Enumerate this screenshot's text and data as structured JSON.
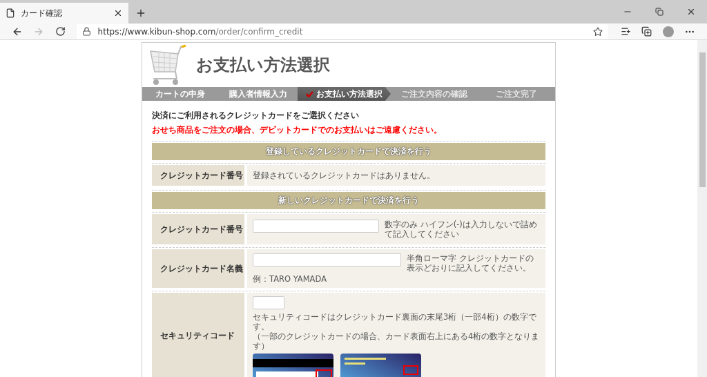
{
  "browser": {
    "tab_title": "カード確認",
    "url_host": "https://www.kibun-shop.com",
    "url_path": "/order/confirm_credit"
  },
  "page": {
    "title": "お支払い方法選択",
    "steps": [
      {
        "label": "カートの中身",
        "selected": false,
        "done": true
      },
      {
        "label": "購入者情報入力",
        "selected": false,
        "done": true
      },
      {
        "label": "お支払い方法選択",
        "selected": true,
        "done": true
      },
      {
        "label": "ご注文内容の確認",
        "selected": false,
        "done": false
      },
      {
        "label": "ご注文完了",
        "selected": false,
        "done": false
      }
    ],
    "intro": "決済にご利用されるクレジットカードをご選択ください",
    "warning": "おせち商品をご注文の場合、デビットカードでのお支払いはご遠慮ください。",
    "sections": [
      {
        "heading": "登録しているクレジットカードで決済を行う",
        "rows": [
          {
            "kind": "text",
            "label": "クレジットカード番号",
            "value": "登録されているクレジットカードはありません。"
          }
        ]
      },
      {
        "heading": "新しいクレジットカードで決済を行う",
        "rows": [
          {
            "kind": "input",
            "label": "クレジットカード番号",
            "hint": "数字のみ ハイフン(-)は入力しないで詰めて記入してください"
          },
          {
            "kind": "input",
            "label": "クレジットカード名義",
            "hint": "半角ローマ字 クレジットカードの表示どおりに記入してください。",
            "example": "例：TARO YAMADA"
          },
          {
            "kind": "security",
            "label": "セキュリティコード",
            "notes": [
              "セキュリティコードはクレジットカード裏面の末尾3桁（一部4桁）の数字です。",
              "（一部のクレジットカードの場合、カード表面右上にある4桁の数字となります）"
            ],
            "cards": [
              {
                "kind": "picture"
              },
              {
                "kind": "picture"
              }
            ]
          }
        ]
      }
    ]
  }
}
